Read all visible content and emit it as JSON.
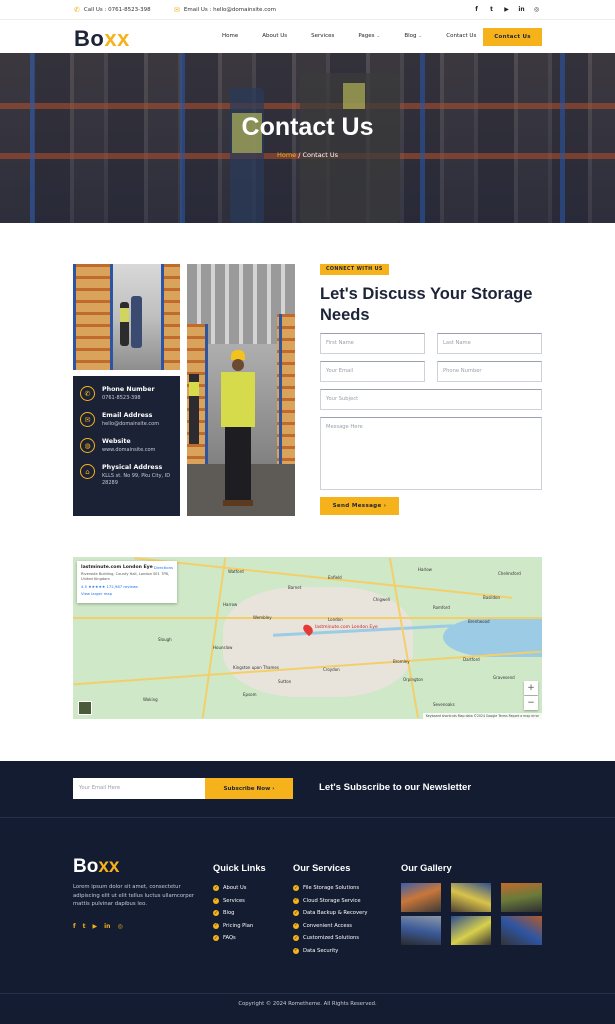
{
  "topbar": {
    "call": "Call Us : 0761-8523-398",
    "email": "Email Us : hello@domainsite.com",
    "socials": [
      "facebook-icon",
      "twitter-icon",
      "youtube-icon",
      "linkedin-icon",
      "instagram-icon"
    ]
  },
  "header": {
    "logo_main": "Bo",
    "logo_accent": "xx",
    "nav": [
      "Home",
      "About Us",
      "Services",
      "Pages",
      "Blog",
      "Contact Us"
    ],
    "cta": "Contact Us"
  },
  "hero": {
    "title": "Contact Us",
    "crumb_home": "Home",
    "crumb_sep": " / ",
    "crumb_current": "Contact Us"
  },
  "contact_info": [
    {
      "icon": "phone-icon",
      "title": "Phone Number",
      "value": "0761-8523-398"
    },
    {
      "icon": "email-icon",
      "title": "Email Address",
      "value": "hello@domainsite.com"
    },
    {
      "icon": "globe-icon",
      "title": "Website",
      "value": "www.domainsite.com"
    },
    {
      "icon": "building-icon",
      "title": "Physical Address",
      "value": "KLLS st. No 99, Pku City, ID 28289"
    }
  ],
  "form": {
    "tag": "CONNECT WITH US",
    "heading": "Let's Discuss Your Storage Needs",
    "first_name": "First Name",
    "last_name": "Last Name",
    "email": "Your Email",
    "phone": "Phone Number",
    "subject": "Your Subject",
    "message": "Message Here",
    "submit": "Send Message"
  },
  "map": {
    "place_name": "lastminute.com London Eye",
    "place_address": "Riverside Building, County Hall, London SE1 7PB, United Kingdom",
    "rating": "4.5 ★★★★★ 172,987 reviews",
    "directions": "Directions",
    "larger_map": "View larger map",
    "pin_label": "lastminute.com London Eye",
    "zoom_in": "+",
    "zoom_out": "−",
    "attribution": "Keyboard shortcuts   Map data ©2024 Google   Terms   Report a map error",
    "places": [
      "Watford",
      "Enfield",
      "Harlow",
      "Barnet",
      "Chigwell",
      "Harrow",
      "Wembley",
      "Romford",
      "Slough",
      "Hounslow",
      "London",
      "Dartford",
      "Bromley",
      "Croydon",
      "Kingston upon Thames",
      "Sutton",
      "Epsom",
      "Orpington",
      "Sevenoaks",
      "Gravesend",
      "Basildon",
      "Chelmsford",
      "Brentwood",
      "Woking"
    ]
  },
  "newsletter": {
    "placeholder": "Your Email Here",
    "button": "Subscribe Now",
    "title": "Let's Subscribe to our Newsletter"
  },
  "footer": {
    "about": "Lorem ipsum dolor sit amet, consectetur adipiscing elit ut elit tellus luctus ullamcorper mattis pulvinar dapibus leo.",
    "socials": [
      "facebook-icon",
      "twitter-icon",
      "youtube-icon",
      "linkedin-icon",
      "instagram-icon"
    ],
    "quick_links_title": "Quick Links",
    "quick_links": [
      "About Us",
      "Services",
      "Blog",
      "Pricing Plan",
      "FAQs"
    ],
    "services_title": "Our Services",
    "services": [
      "File Storage Solutions",
      "Cloud Storage Service",
      "Data Backup & Recovery",
      "Convenient Access",
      "Customized Solutions",
      "Data Security"
    ],
    "gallery_title": "Our Gallery",
    "copyright": "Copyright © 2024 Rometheme. All Rights Reserved."
  },
  "colors": {
    "accent": "#f6b21b",
    "navy": "#141c31",
    "dark": "#1d2438"
  }
}
